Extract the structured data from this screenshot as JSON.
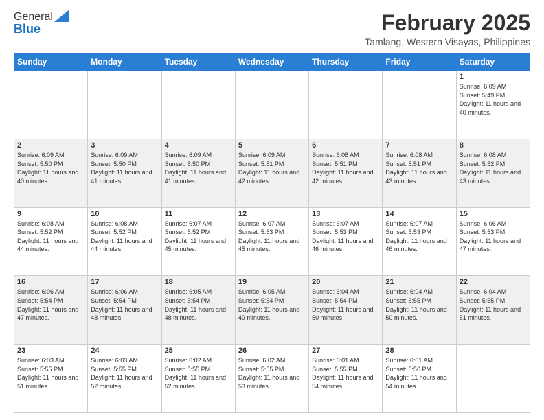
{
  "header": {
    "logo_line1": "General",
    "logo_line2": "Blue",
    "month_title": "February 2025",
    "location": "Tamlang, Western Visayas, Philippines"
  },
  "weekdays": [
    "Sunday",
    "Monday",
    "Tuesday",
    "Wednesday",
    "Thursday",
    "Friday",
    "Saturday"
  ],
  "weeks": [
    [
      {
        "day": "",
        "info": ""
      },
      {
        "day": "",
        "info": ""
      },
      {
        "day": "",
        "info": ""
      },
      {
        "day": "",
        "info": ""
      },
      {
        "day": "",
        "info": ""
      },
      {
        "day": "",
        "info": ""
      },
      {
        "day": "1",
        "info": "Sunrise: 6:09 AM\nSunset: 5:49 PM\nDaylight: 11 hours and 40 minutes."
      }
    ],
    [
      {
        "day": "2",
        "info": "Sunrise: 6:09 AM\nSunset: 5:50 PM\nDaylight: 11 hours and 40 minutes."
      },
      {
        "day": "3",
        "info": "Sunrise: 6:09 AM\nSunset: 5:50 PM\nDaylight: 11 hours and 41 minutes."
      },
      {
        "day": "4",
        "info": "Sunrise: 6:09 AM\nSunset: 5:50 PM\nDaylight: 11 hours and 41 minutes."
      },
      {
        "day": "5",
        "info": "Sunrise: 6:09 AM\nSunset: 5:51 PM\nDaylight: 11 hours and 42 minutes."
      },
      {
        "day": "6",
        "info": "Sunrise: 6:08 AM\nSunset: 5:51 PM\nDaylight: 11 hours and 42 minutes."
      },
      {
        "day": "7",
        "info": "Sunrise: 6:08 AM\nSunset: 5:51 PM\nDaylight: 11 hours and 43 minutes."
      },
      {
        "day": "8",
        "info": "Sunrise: 6:08 AM\nSunset: 5:52 PM\nDaylight: 11 hours and 43 minutes."
      }
    ],
    [
      {
        "day": "9",
        "info": "Sunrise: 6:08 AM\nSunset: 5:52 PM\nDaylight: 11 hours and 44 minutes."
      },
      {
        "day": "10",
        "info": "Sunrise: 6:08 AM\nSunset: 5:52 PM\nDaylight: 11 hours and 44 minutes."
      },
      {
        "day": "11",
        "info": "Sunrise: 6:07 AM\nSunset: 5:52 PM\nDaylight: 11 hours and 45 minutes."
      },
      {
        "day": "12",
        "info": "Sunrise: 6:07 AM\nSunset: 5:53 PM\nDaylight: 11 hours and 45 minutes."
      },
      {
        "day": "13",
        "info": "Sunrise: 6:07 AM\nSunset: 5:53 PM\nDaylight: 11 hours and 46 minutes."
      },
      {
        "day": "14",
        "info": "Sunrise: 6:07 AM\nSunset: 5:53 PM\nDaylight: 11 hours and 46 minutes."
      },
      {
        "day": "15",
        "info": "Sunrise: 6:06 AM\nSunset: 5:53 PM\nDaylight: 11 hours and 47 minutes."
      }
    ],
    [
      {
        "day": "16",
        "info": "Sunrise: 6:06 AM\nSunset: 5:54 PM\nDaylight: 11 hours and 47 minutes."
      },
      {
        "day": "17",
        "info": "Sunrise: 6:06 AM\nSunset: 5:54 PM\nDaylight: 11 hours and 48 minutes."
      },
      {
        "day": "18",
        "info": "Sunrise: 6:05 AM\nSunset: 5:54 PM\nDaylight: 11 hours and 48 minutes."
      },
      {
        "day": "19",
        "info": "Sunrise: 6:05 AM\nSunset: 5:54 PM\nDaylight: 11 hours and 49 minutes."
      },
      {
        "day": "20",
        "info": "Sunrise: 6:04 AM\nSunset: 5:54 PM\nDaylight: 11 hours and 50 minutes."
      },
      {
        "day": "21",
        "info": "Sunrise: 6:04 AM\nSunset: 5:55 PM\nDaylight: 11 hours and 50 minutes."
      },
      {
        "day": "22",
        "info": "Sunrise: 6:04 AM\nSunset: 5:55 PM\nDaylight: 11 hours and 51 minutes."
      }
    ],
    [
      {
        "day": "23",
        "info": "Sunrise: 6:03 AM\nSunset: 5:55 PM\nDaylight: 11 hours and 51 minutes."
      },
      {
        "day": "24",
        "info": "Sunrise: 6:03 AM\nSunset: 5:55 PM\nDaylight: 11 hours and 52 minutes."
      },
      {
        "day": "25",
        "info": "Sunrise: 6:02 AM\nSunset: 5:55 PM\nDaylight: 11 hours and 52 minutes."
      },
      {
        "day": "26",
        "info": "Sunrise: 6:02 AM\nSunset: 5:55 PM\nDaylight: 11 hours and 53 minutes."
      },
      {
        "day": "27",
        "info": "Sunrise: 6:01 AM\nSunset: 5:55 PM\nDaylight: 11 hours and 54 minutes."
      },
      {
        "day": "28",
        "info": "Sunrise: 6:01 AM\nSunset: 5:56 PM\nDaylight: 11 hours and 54 minutes."
      },
      {
        "day": "",
        "info": ""
      }
    ]
  ]
}
